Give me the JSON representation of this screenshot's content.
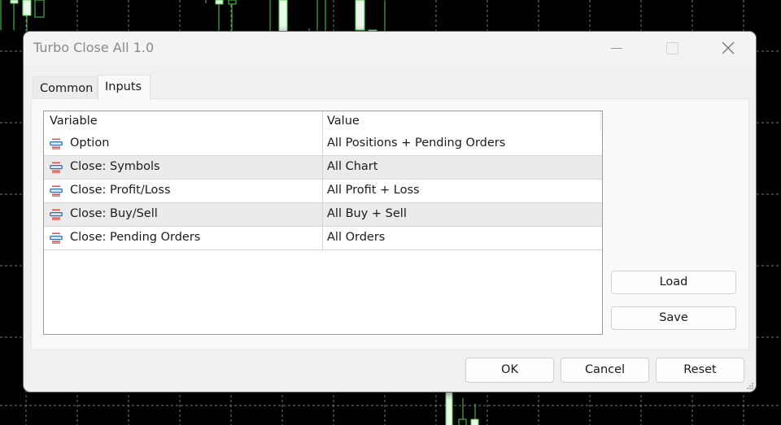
{
  "window": {
    "title": "Turbo Close All 1.0",
    "controls": [
      "minimize",
      "maximize",
      "close"
    ]
  },
  "tabs": [
    {
      "label": "Common",
      "active": false
    },
    {
      "label": "Inputs",
      "active": true
    }
  ],
  "inputs_table": {
    "columns": [
      "Variable",
      "Value"
    ],
    "rows": [
      {
        "icon": "enum-parameter-icon",
        "variable": "Option",
        "value": "All Positions + Pending Orders"
      },
      {
        "icon": "enum-parameter-icon",
        "variable": "Close: Symbols",
        "value": "All Chart"
      },
      {
        "icon": "enum-parameter-icon",
        "variable": "Close: Profit/Loss",
        "value": "All Profit + Loss"
      },
      {
        "icon": "enum-parameter-icon",
        "variable": "Close: Buy/Sell",
        "value": "All Buy + Sell"
      },
      {
        "icon": "enum-parameter-icon",
        "variable": "Close: Pending Orders",
        "value": "All Orders"
      }
    ]
  },
  "side_buttons": {
    "load": "Load",
    "save": "Save"
  },
  "footer_buttons": {
    "ok": "OK",
    "cancel": "Cancel",
    "reset": "Reset"
  },
  "colors": {
    "chart_background": "#000000",
    "candle_color": "#4fd14f",
    "grid_line": "#7a7a7a",
    "dialog_background": "#f0f0f0",
    "icon_red": "#d9534f",
    "icon_blue": "#2f6fb0"
  }
}
